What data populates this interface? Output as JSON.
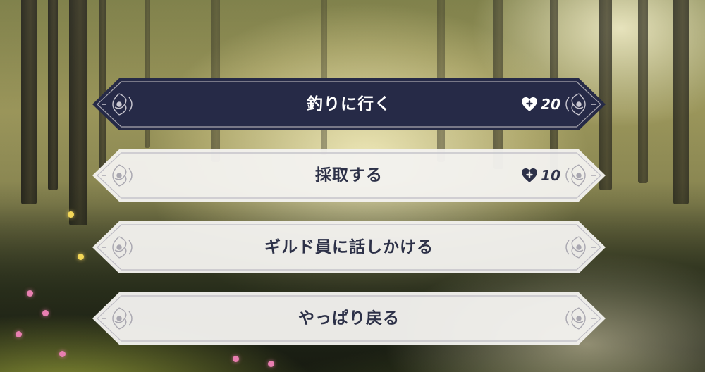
{
  "colors": {
    "selected_fill": "#262a47",
    "default_fill": "#f3f1ee",
    "text_dark": "#2d3148",
    "text_light": "#ffffff",
    "frame_ornament": "#a9a7b0"
  },
  "menu": {
    "options": [
      {
        "label": "釣りに行く",
        "cost": "20",
        "cost_icon": "heart-plus-icon",
        "selected": true
      },
      {
        "label": "採取する",
        "cost": "10",
        "cost_icon": "heart-plus-icon",
        "selected": false
      },
      {
        "label": "ギルド員に話しかける",
        "selected": false
      },
      {
        "label": "やっぱり戻る",
        "selected": false
      }
    ]
  }
}
